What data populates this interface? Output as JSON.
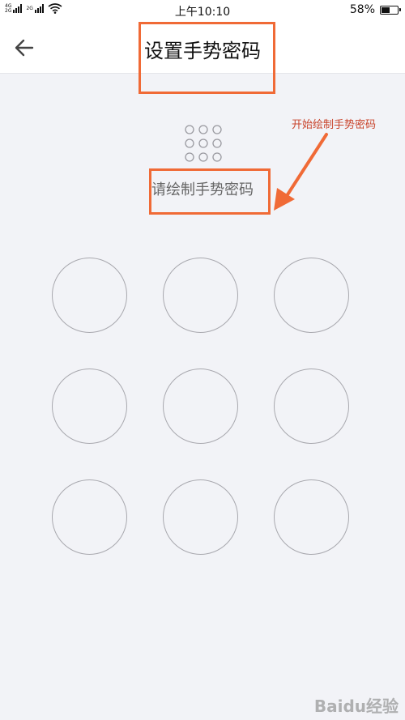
{
  "status_bar": {
    "network1": "4G",
    "network1_sub": "2G",
    "network2": "2G",
    "time": "上午10:10",
    "battery_percent": "58%",
    "battery_level": 0.58
  },
  "header": {
    "title": "设置手势密码",
    "back_icon": "arrow-left-icon"
  },
  "annotation": {
    "callout": "开始绘制手势密码",
    "color": "#f06a36"
  },
  "gesture": {
    "hint": "请绘制手势密码",
    "nodes": [
      "1",
      "2",
      "3",
      "4",
      "5",
      "6",
      "7",
      "8",
      "9"
    ]
  },
  "watermark": "Baidu经验"
}
